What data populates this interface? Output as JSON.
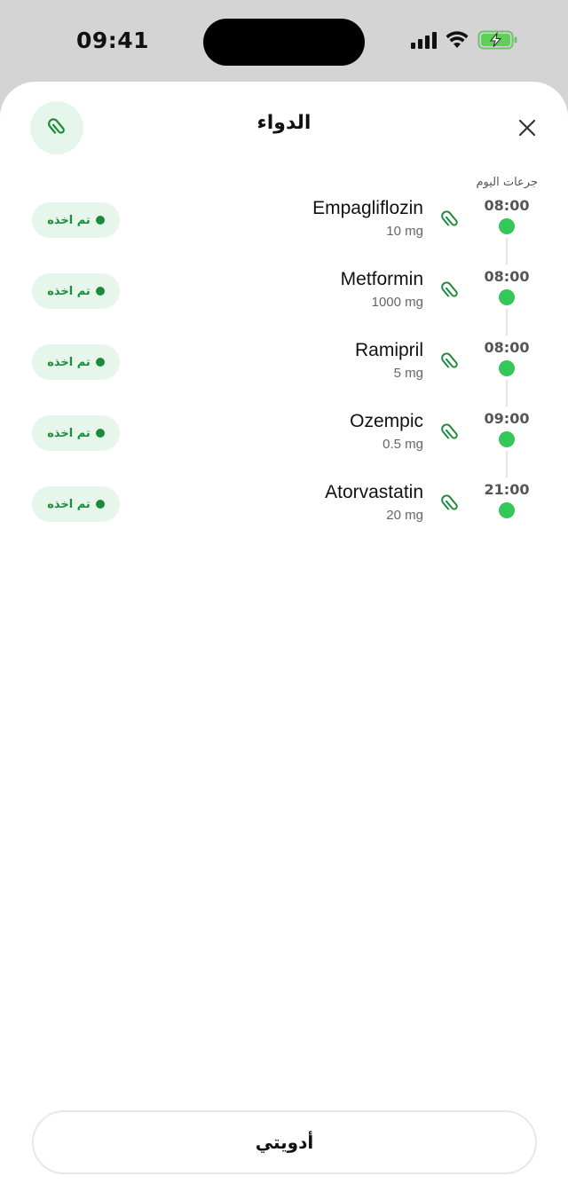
{
  "status_bar": {
    "time": "09:41",
    "signal_icon": "cellular-signal-icon",
    "wifi_icon": "wifi-icon",
    "battery_icon": "battery-charging-icon"
  },
  "sheet": {
    "title": "الدواء",
    "attach_icon": "paperclip-icon",
    "close_icon": "close-icon",
    "today_label": "جرعات اليوم"
  },
  "doses": [
    {
      "time": "08:00",
      "name": "Empagliflozin",
      "dose": "10 mg",
      "status": "تم اخذه"
    },
    {
      "time": "08:00",
      "name": "Metformin",
      "dose": "1000 mg",
      "status": "تم اخذه"
    },
    {
      "time": "08:00",
      "name": "Ramipril",
      "dose": "5 mg",
      "status": "تم اخذه"
    },
    {
      "time": "09:00",
      "name": "Ozempic",
      "dose": "0.5 mg",
      "status": "تم اخذه"
    },
    {
      "time": "21:00",
      "name": "Atorvastatin",
      "dose": "20 mg",
      "status": "تم اخذه"
    }
  ],
  "footer": {
    "my_meds_label": "أدويتي"
  },
  "colors": {
    "accent_green": "#34c759",
    "status_green": "#1e8b3c",
    "badge_bg": "#e7f6ea"
  }
}
